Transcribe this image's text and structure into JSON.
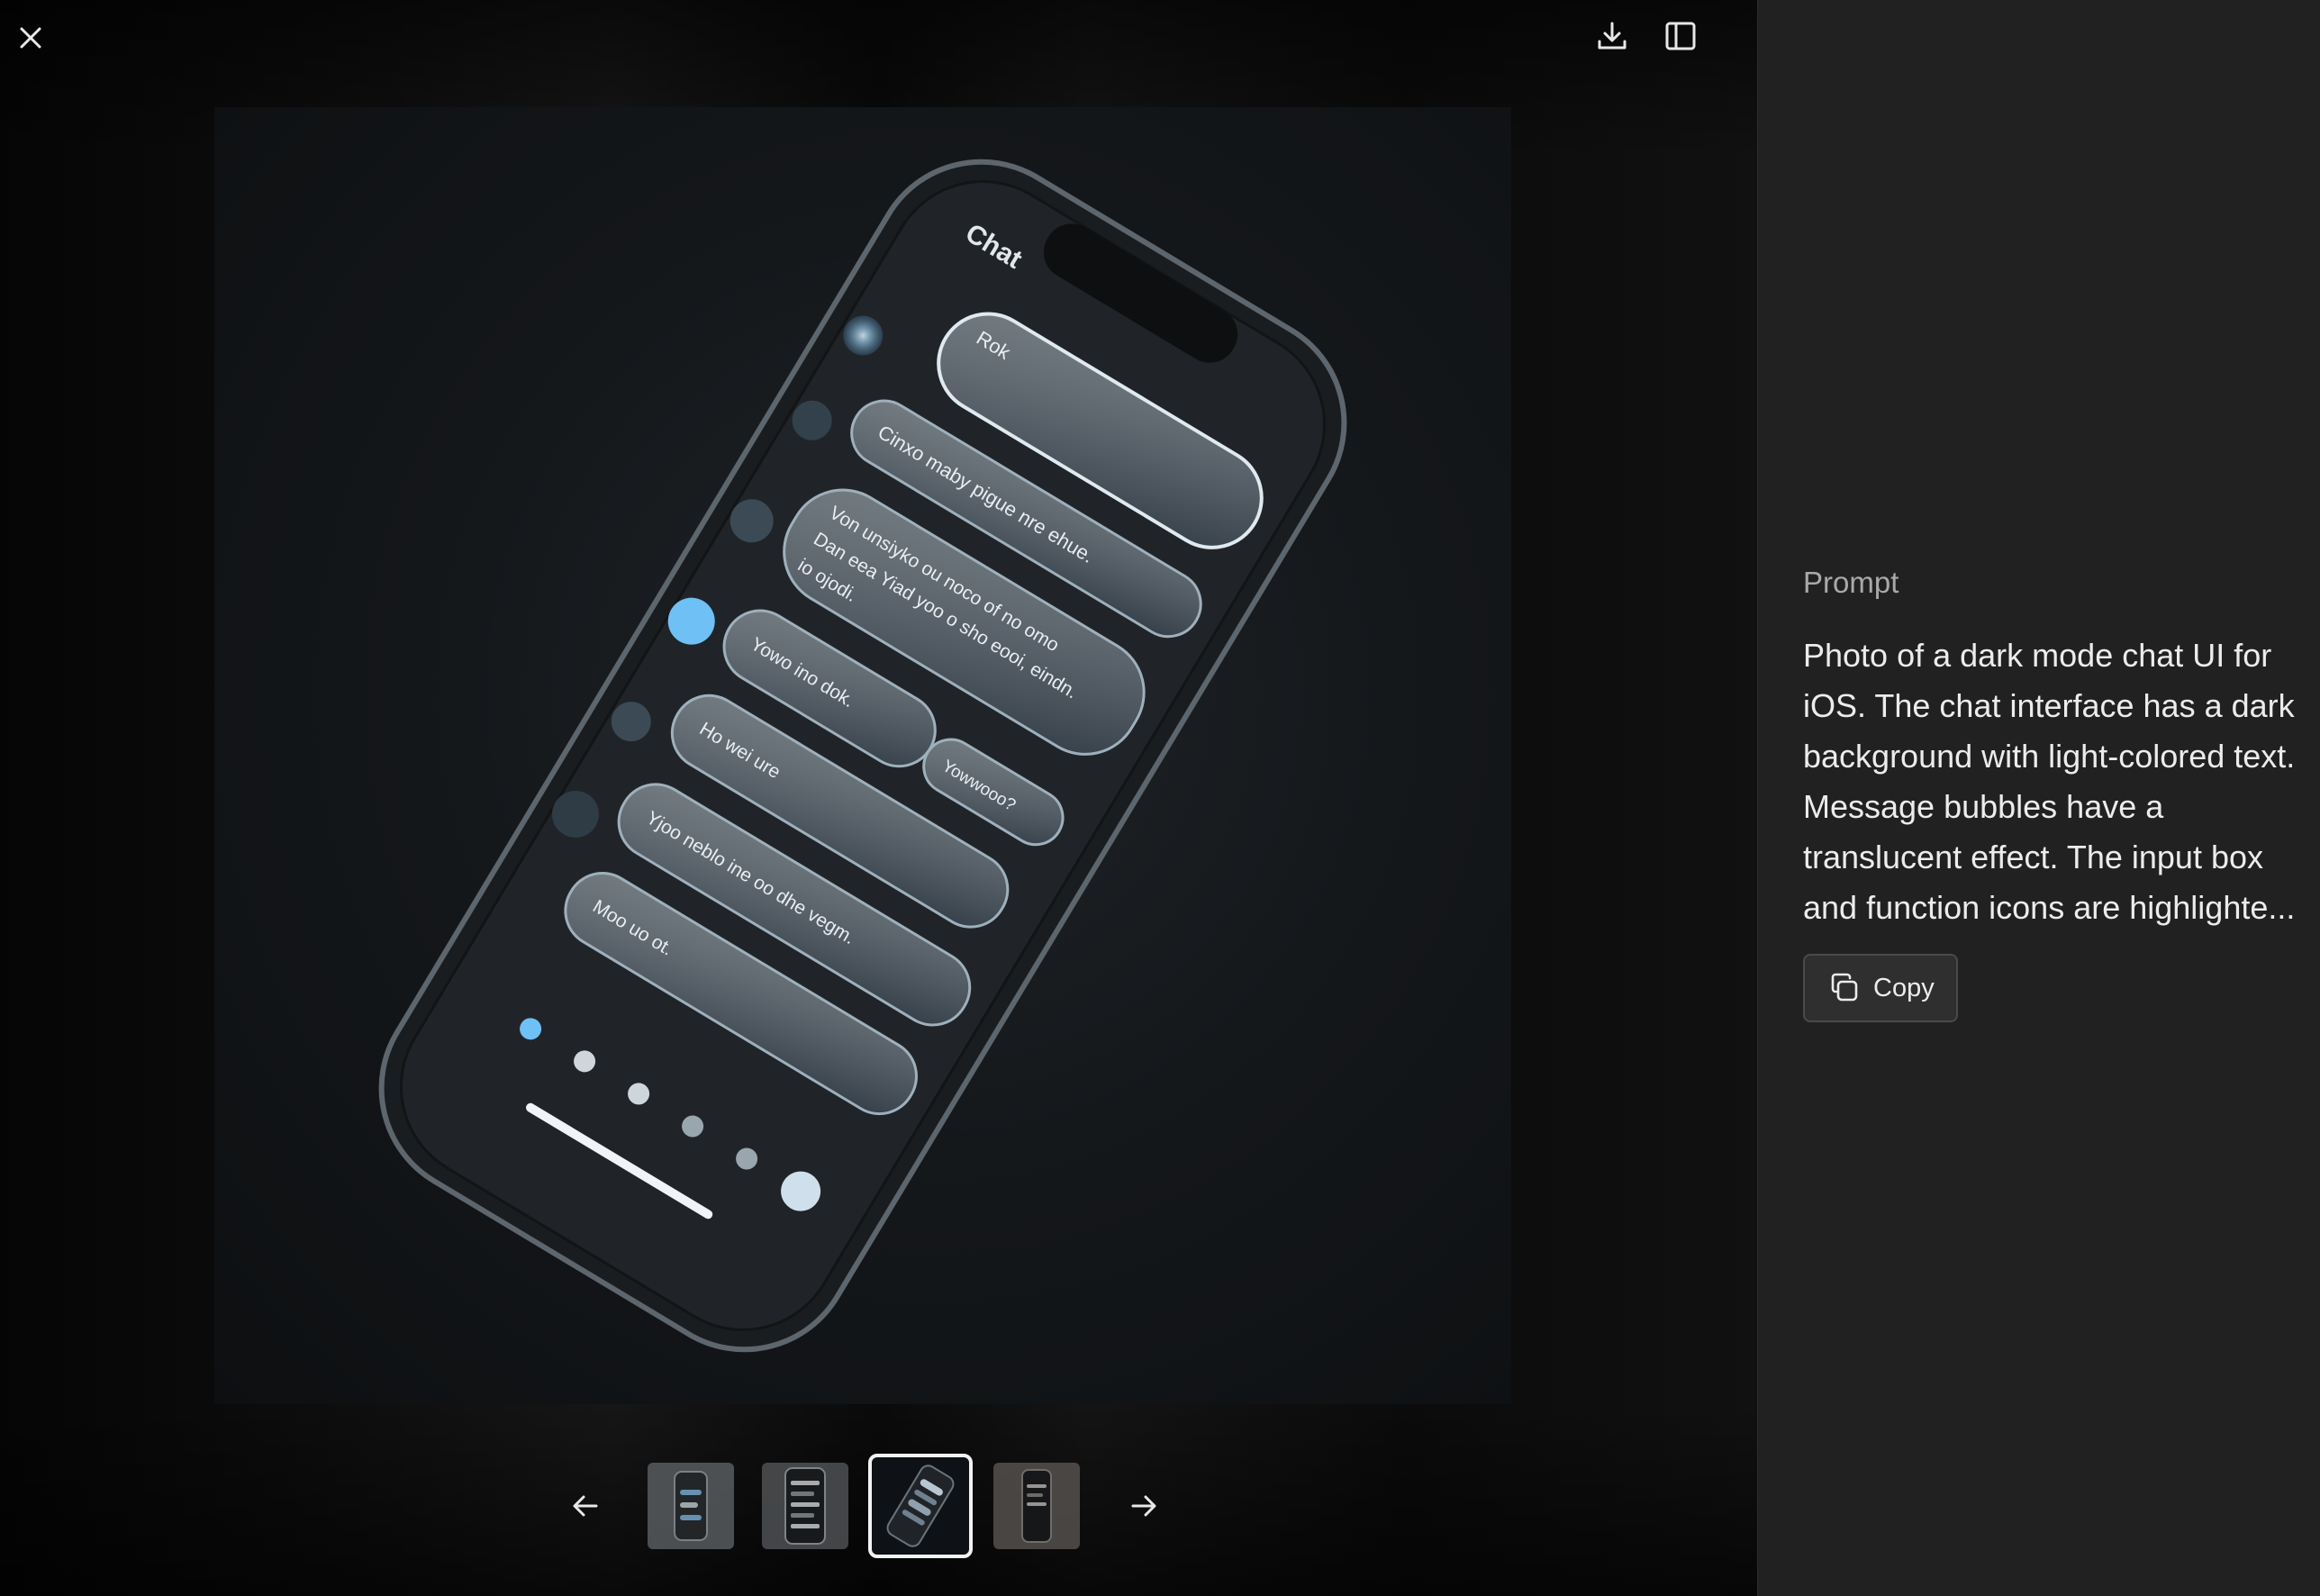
{
  "viewer": {
    "close_icon": "close-icon",
    "download_icon": "download-icon",
    "sidebar_icon": "sidebar-toggle-icon",
    "main_image": {
      "screen_labels": [
        "Chat",
        "Rok",
        "Cinxo maby pigue nre ehue.",
        "Von unsiyko ou noco of no omo",
        "Dan eea Yiad yoo o sho eooi, eindn.",
        "io ojodi.",
        "Yowo ino dok.",
        "Ho wei ure",
        "Yowwooo?",
        "Yjoo neblo ine oo dhe vegm.",
        "Moo uo ot."
      ]
    },
    "thumbnails": [
      {
        "active": false
      },
      {
        "active": false
      },
      {
        "active": true
      },
      {
        "active": false
      }
    ],
    "prev_icon": "arrow-left-icon",
    "next_icon": "arrow-right-icon"
  },
  "panel": {
    "label": "Prompt",
    "prompt_text": "Photo of a dark mode chat UI for iOS. The chat interface has a dark background with light-colored text. Message bubbles have a translucent effect. The input box and function icons are highlighte...",
    "copy_label": "Copy",
    "copy_icon": "copy-icon"
  },
  "colors": {
    "panel_bg": "#212121",
    "accent_glow": "#8fd0ff"
  }
}
